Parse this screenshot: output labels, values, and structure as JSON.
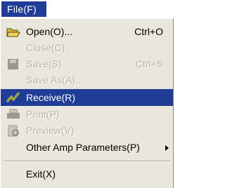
{
  "menubar": {
    "file_label": "File(F)"
  },
  "menu": {
    "open": {
      "label": "Open(O)...",
      "accel": "Ctrl+O"
    },
    "close": {
      "label": "Close(C)"
    },
    "save": {
      "label": "Save(S)",
      "accel": "Ctrl+S"
    },
    "save_as": {
      "label": "Save As(A)..."
    },
    "receive": {
      "label": "Receive(R)"
    },
    "print": {
      "label": "Print(P)"
    },
    "preview": {
      "label": "Preview(V)"
    },
    "other_amp": {
      "label": "Other Amp Parameters(P)"
    },
    "exit": {
      "label": "Exit(X)"
    }
  },
  "colors": {
    "highlight": "#1f3d96",
    "menu_bg": "#e9e6dc",
    "disabled_text": "#b7b4ab"
  },
  "icons": {
    "open": "folder-open-icon",
    "save": "save-disk-icon",
    "receive": "receive-wave-icon",
    "print": "printer-icon",
    "preview": "preview-page-icon",
    "submenu": "submenu-arrow-icon"
  }
}
